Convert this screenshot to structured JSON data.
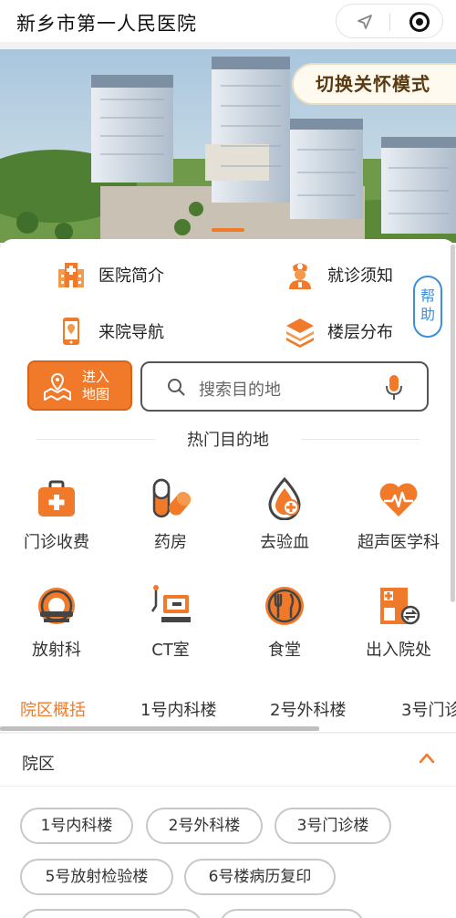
{
  "app": {
    "title": "新乡市第一人民医院"
  },
  "banner": {
    "care_mode_label": "切换关怀模式"
  },
  "quick_links": [
    {
      "label": "医院简介",
      "icon": "hospital-icon"
    },
    {
      "label": "就诊须知",
      "icon": "nurse-icon"
    },
    {
      "label": "来院导航",
      "icon": "phone-navigation-icon"
    },
    {
      "label": "楼层分布",
      "icon": "layers-icon"
    }
  ],
  "help_label": "帮助",
  "map_button": {
    "line1": "进入",
    "line2": "地图"
  },
  "search": {
    "placeholder": "搜索目的地"
  },
  "hot": {
    "title": "热门目的地",
    "items": [
      {
        "label": "门诊收费",
        "icon": "medical-bag-icon"
      },
      {
        "label": "药房",
        "icon": "pill-capsule-icon"
      },
      {
        "label": "去验血",
        "icon": "blood-drop-icon"
      },
      {
        "label": "超声医学科",
        "icon": "heart-pulse-icon"
      },
      {
        "label": "放射科",
        "icon": "scanner-icon"
      },
      {
        "label": "CT室",
        "icon": "ct-monitor-icon"
      },
      {
        "label": "食堂",
        "icon": "fork-knife-icon"
      },
      {
        "label": "出入院处",
        "icon": "hospital-exchange-icon"
      }
    ]
  },
  "tabs": {
    "active": 0,
    "items": [
      "院区概括",
      "1号内科楼",
      "2号外科楼",
      "3号门诊"
    ]
  },
  "section": {
    "label": "院区"
  },
  "buildings": [
    "1号内科楼",
    "2号外科楼",
    "3号门诊楼",
    "5号放射检验楼",
    "6号楼病历复印"
  ],
  "colors": {
    "accent": "#f07a2a",
    "help": "#3f8fd8"
  }
}
